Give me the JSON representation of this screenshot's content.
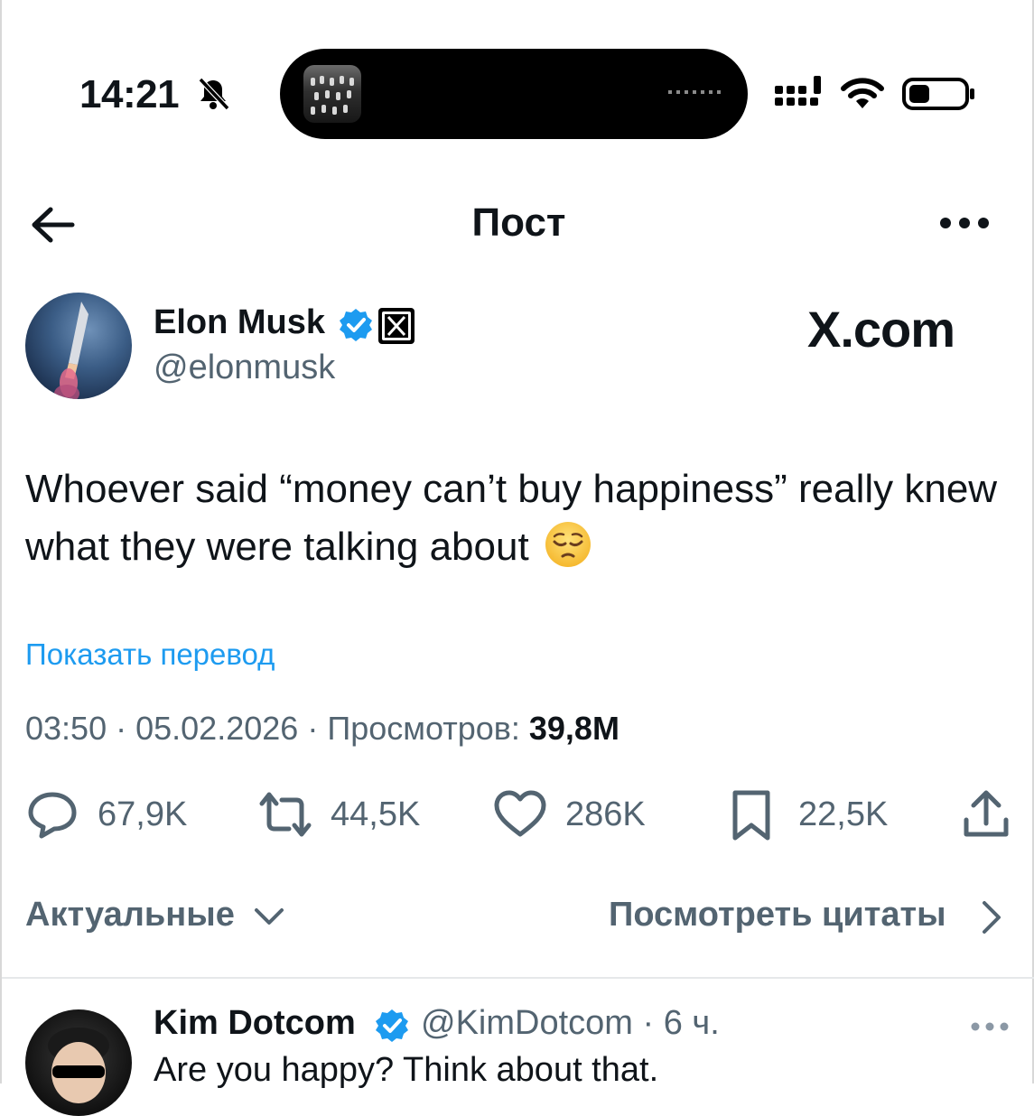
{
  "status_bar": {
    "time": "14:21"
  },
  "header": {
    "title": "Пост"
  },
  "post": {
    "author_name": "Elon Musk",
    "author_handle": "@elonmusk",
    "watermark": "X.com",
    "text": "Whoever said “money can’t buy happiness” really knew what they were talking about",
    "emoji": "pensive-face",
    "translate_label": "Показать перевод",
    "meta_time": "03:50",
    "meta_date": "05.02.2026",
    "meta_views_label": "Просмотров:",
    "meta_views_value": "39,8M"
  },
  "actions": {
    "replies": "67,9K",
    "reposts": "44,5K",
    "likes": "286K",
    "bookmarks": "22,5K"
  },
  "filters": {
    "sort_label": "Актуальные",
    "quotes_label": "Посмотреть цитаты"
  },
  "reply": {
    "author_name": "Kim Dotcom",
    "author_handle": "@KimDotcom",
    "time_ago": "6 ч.",
    "text": "Are you happy? Think about that."
  },
  "colors": {
    "accent": "#1d9bf0",
    "secondary_text": "#536471",
    "primary_text": "#0f1419",
    "verified": "#1d9bf0"
  }
}
